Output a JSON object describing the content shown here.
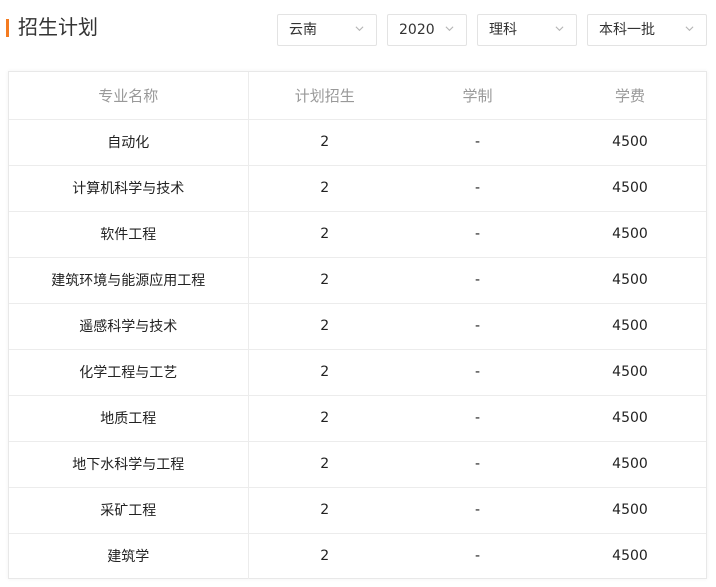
{
  "header": {
    "title": "招生计划",
    "filters": [
      {
        "name": "province-select",
        "value": "云南"
      },
      {
        "name": "year-select",
        "value": "2020"
      },
      {
        "name": "subject-select",
        "value": "理科"
      },
      {
        "name": "batch-select",
        "value": "本科一批"
      }
    ]
  },
  "table": {
    "columns": [
      "专业名称",
      "计划招生",
      "学制",
      "学费"
    ],
    "rows": [
      [
        "自动化",
        "2",
        "-",
        "4500"
      ],
      [
        "计算机科学与技术",
        "2",
        "-",
        "4500"
      ],
      [
        "软件工程",
        "2",
        "-",
        "4500"
      ],
      [
        "建筑环境与能源应用工程",
        "2",
        "-",
        "4500"
      ],
      [
        "遥感科学与技术",
        "2",
        "-",
        "4500"
      ],
      [
        "化学工程与工艺",
        "2",
        "-",
        "4500"
      ],
      [
        "地质工程",
        "2",
        "-",
        "4500"
      ],
      [
        "地下水科学与工程",
        "2",
        "-",
        "4500"
      ],
      [
        "采矿工程",
        "2",
        "-",
        "4500"
      ],
      [
        "建筑学",
        "2",
        "-",
        "4500"
      ]
    ]
  },
  "colors": {
    "accent": "#f47b20",
    "header_text": "#999999",
    "border": "#ececec"
  }
}
